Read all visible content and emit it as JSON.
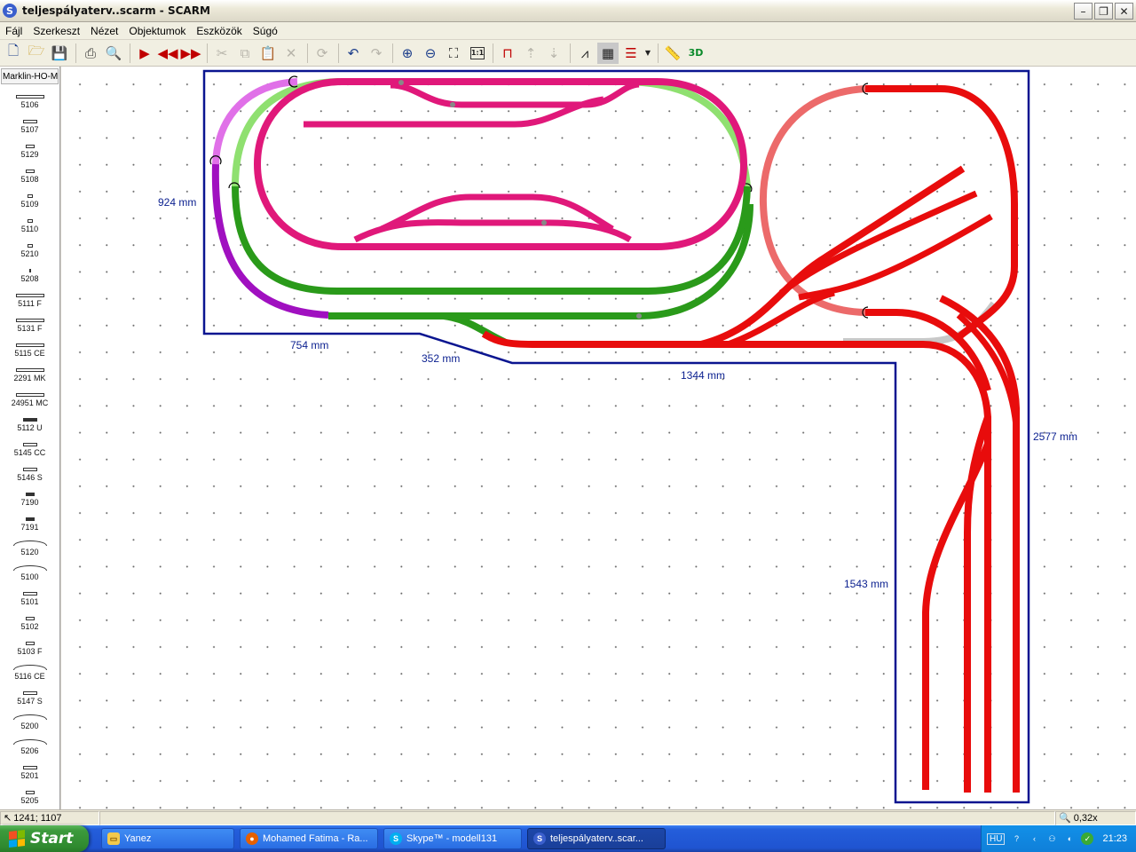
{
  "window": {
    "title": "teljespályaterv..scarm - SCARM",
    "app_icon": "S"
  },
  "menu": [
    "Fájl",
    "Szerkeszt",
    "Nézet",
    "Objektumok",
    "Eszközök",
    "Súgó"
  ],
  "toolbar": {
    "view3d_label": "3D",
    "zoom11_label": "1:1"
  },
  "library": {
    "selected": "Marklin-HO-M",
    "parts": [
      {
        "code": "5106",
        "shape": "straight-long"
      },
      {
        "code": "5107",
        "shape": "straight"
      },
      {
        "code": "5129",
        "shape": "straight-short"
      },
      {
        "code": "5108",
        "shape": "straight-short"
      },
      {
        "code": "5109",
        "shape": "straight-tiny"
      },
      {
        "code": "5110",
        "shape": "straight-tiny"
      },
      {
        "code": "5210",
        "shape": "straight-tiny"
      },
      {
        "code": "5208",
        "shape": "straight-dot"
      },
      {
        "code": "5111 F",
        "shape": "straight-long"
      },
      {
        "code": "5131 F",
        "shape": "straight-long"
      },
      {
        "code": "5115 CE",
        "shape": "straight-long"
      },
      {
        "code": "2291 MK",
        "shape": "straight-long"
      },
      {
        "code": "24951 MC",
        "shape": "straight-long"
      },
      {
        "code": "5112 U",
        "shape": "uncoupler"
      },
      {
        "code": "5145 CC",
        "shape": "straight"
      },
      {
        "code": "5146 S",
        "shape": "straight"
      },
      {
        "code": "7190",
        "shape": "bumper"
      },
      {
        "code": "7191",
        "shape": "bumper"
      },
      {
        "code": "5120",
        "shape": "curve"
      },
      {
        "code": "5100",
        "shape": "curve"
      },
      {
        "code": "5101",
        "shape": "straight"
      },
      {
        "code": "5102",
        "shape": "straight-short"
      },
      {
        "code": "5103 F",
        "shape": "straight-short"
      },
      {
        "code": "5116 CE",
        "shape": "curve"
      },
      {
        "code": "5147 S",
        "shape": "straight"
      },
      {
        "code": "5200",
        "shape": "curve"
      },
      {
        "code": "5206",
        "shape": "curve"
      },
      {
        "code": "5201",
        "shape": "straight"
      },
      {
        "code": "5205",
        "shape": "straight-short"
      }
    ]
  },
  "dimensions": {
    "height_left": "924 mm",
    "bottom_left": "754 mm",
    "diagonal": "352 mm",
    "bottom_mid": "1344 mm",
    "right_side": "2577 mm",
    "leg_height": "1543 mm"
  },
  "colors": {
    "pink": "#e0187a",
    "magenta": "#a010c0",
    "light_magenta": "#e070e8",
    "green": "#2a9a1a",
    "light_green": "#8fe070",
    "red": "#e80c0c",
    "salmon": "#ec6a6a",
    "outline": "#0a1590"
  },
  "status": {
    "coords": "1241; 1107",
    "zoom": "0,32x"
  },
  "taskbar": {
    "start": "Start",
    "tasks": [
      {
        "label": "Yanez",
        "icon": "folder-icon"
      },
      {
        "label": "Mohamed Fatima - Ra...",
        "icon": "firefox-icon"
      },
      {
        "label": "Skype™ - modell131",
        "icon": "skype-icon"
      },
      {
        "label": "teljespályaterv..scar...",
        "icon": "scarm-icon",
        "active": true
      }
    ],
    "lang": "HU",
    "clock": "21:23"
  }
}
